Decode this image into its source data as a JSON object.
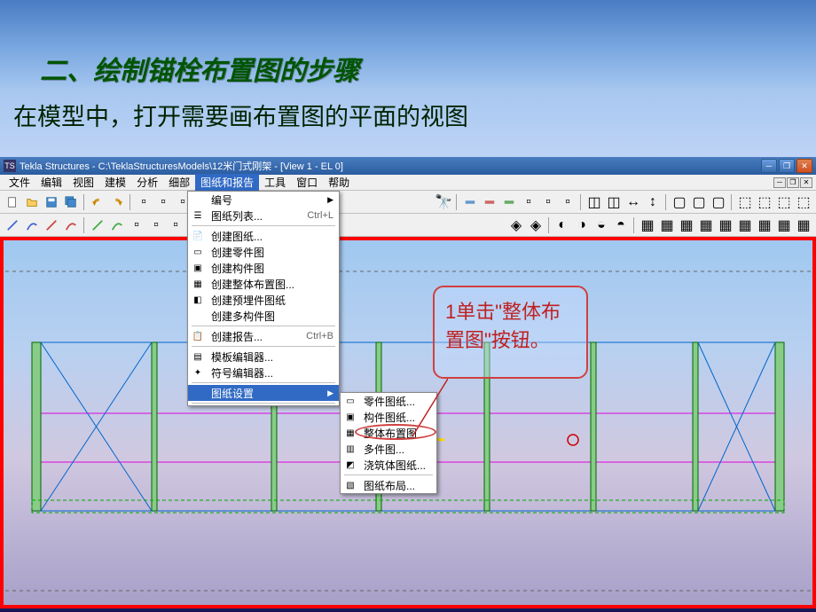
{
  "slide": {
    "title": "二、绘制锚栓布置图的步骤",
    "subtitle": "在模型中，打开需要画布置图的平面的视图"
  },
  "window": {
    "title": "Tekla Structures - C:\\TeklaStructuresModels\\12米门式刚架 - [View 1 - EL 0]",
    "icon_text": "TS"
  },
  "menubar": {
    "items": [
      "文件",
      "编辑",
      "视图",
      "建模",
      "分析",
      "细部",
      "图纸和报告",
      "工具",
      "窗口",
      "帮助"
    ],
    "active_index": 6
  },
  "dropdown": {
    "items": [
      {
        "type": "item",
        "label": "编号",
        "arrow": true
      },
      {
        "type": "item",
        "label": "图纸列表...",
        "shortcut": "Ctrl+L",
        "icon": "list"
      },
      {
        "type": "sep"
      },
      {
        "type": "item",
        "label": "创建图纸...",
        "icon": "doc"
      },
      {
        "type": "item",
        "label": "创建零件图",
        "icon": "part"
      },
      {
        "type": "item",
        "label": "创建构件图",
        "icon": "assembly"
      },
      {
        "type": "item",
        "label": "创建整体布置图...",
        "icon": "ga"
      },
      {
        "type": "item",
        "label": "创建预埋件图纸",
        "icon": "embed"
      },
      {
        "type": "item",
        "label": "创建多构件图",
        "icon": "multi"
      },
      {
        "type": "sep"
      },
      {
        "type": "item",
        "label": "创建报告...",
        "shortcut": "Ctrl+B",
        "icon": "report"
      },
      {
        "type": "sep"
      },
      {
        "type": "item",
        "label": "模板编辑器...",
        "icon": "template"
      },
      {
        "type": "item",
        "label": "符号编辑器...",
        "icon": "symbol"
      },
      {
        "type": "sep"
      },
      {
        "type": "item",
        "label": "图纸设置",
        "arrow": true,
        "highlighted": true
      },
      {
        "type": "sep"
      }
    ]
  },
  "submenu": {
    "items": [
      {
        "label": "零件图纸...",
        "icon": "part"
      },
      {
        "label": "构件图纸...",
        "icon": "assembly"
      },
      {
        "label": "整体布置图",
        "icon": "ga",
        "circled": true
      },
      {
        "label": "多件图...",
        "icon": "multi"
      },
      {
        "label": "浇筑体图纸...",
        "icon": "cast"
      },
      {
        "type": "sep"
      },
      {
        "label": "图纸布局...",
        "icon": "layout"
      }
    ]
  },
  "callout": {
    "text": "1单击\"整体布置图\"按钮。"
  }
}
